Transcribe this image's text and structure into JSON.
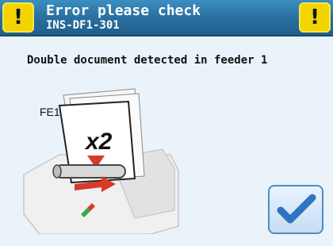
{
  "header": {
    "title": "Error please check",
    "code": "INS-DF1-301",
    "left_icon": "warning-icon",
    "right_icon": "warning-icon",
    "bg_color": "#2a6f9f",
    "warning_color": "#f3d400"
  },
  "message": "Double document detected in feeder 1",
  "illustration": {
    "feeder_label": "FE1",
    "count_label": "x2"
  },
  "confirm_button": {
    "icon": "checkmark-icon",
    "accent_color": "#2f73c2"
  }
}
